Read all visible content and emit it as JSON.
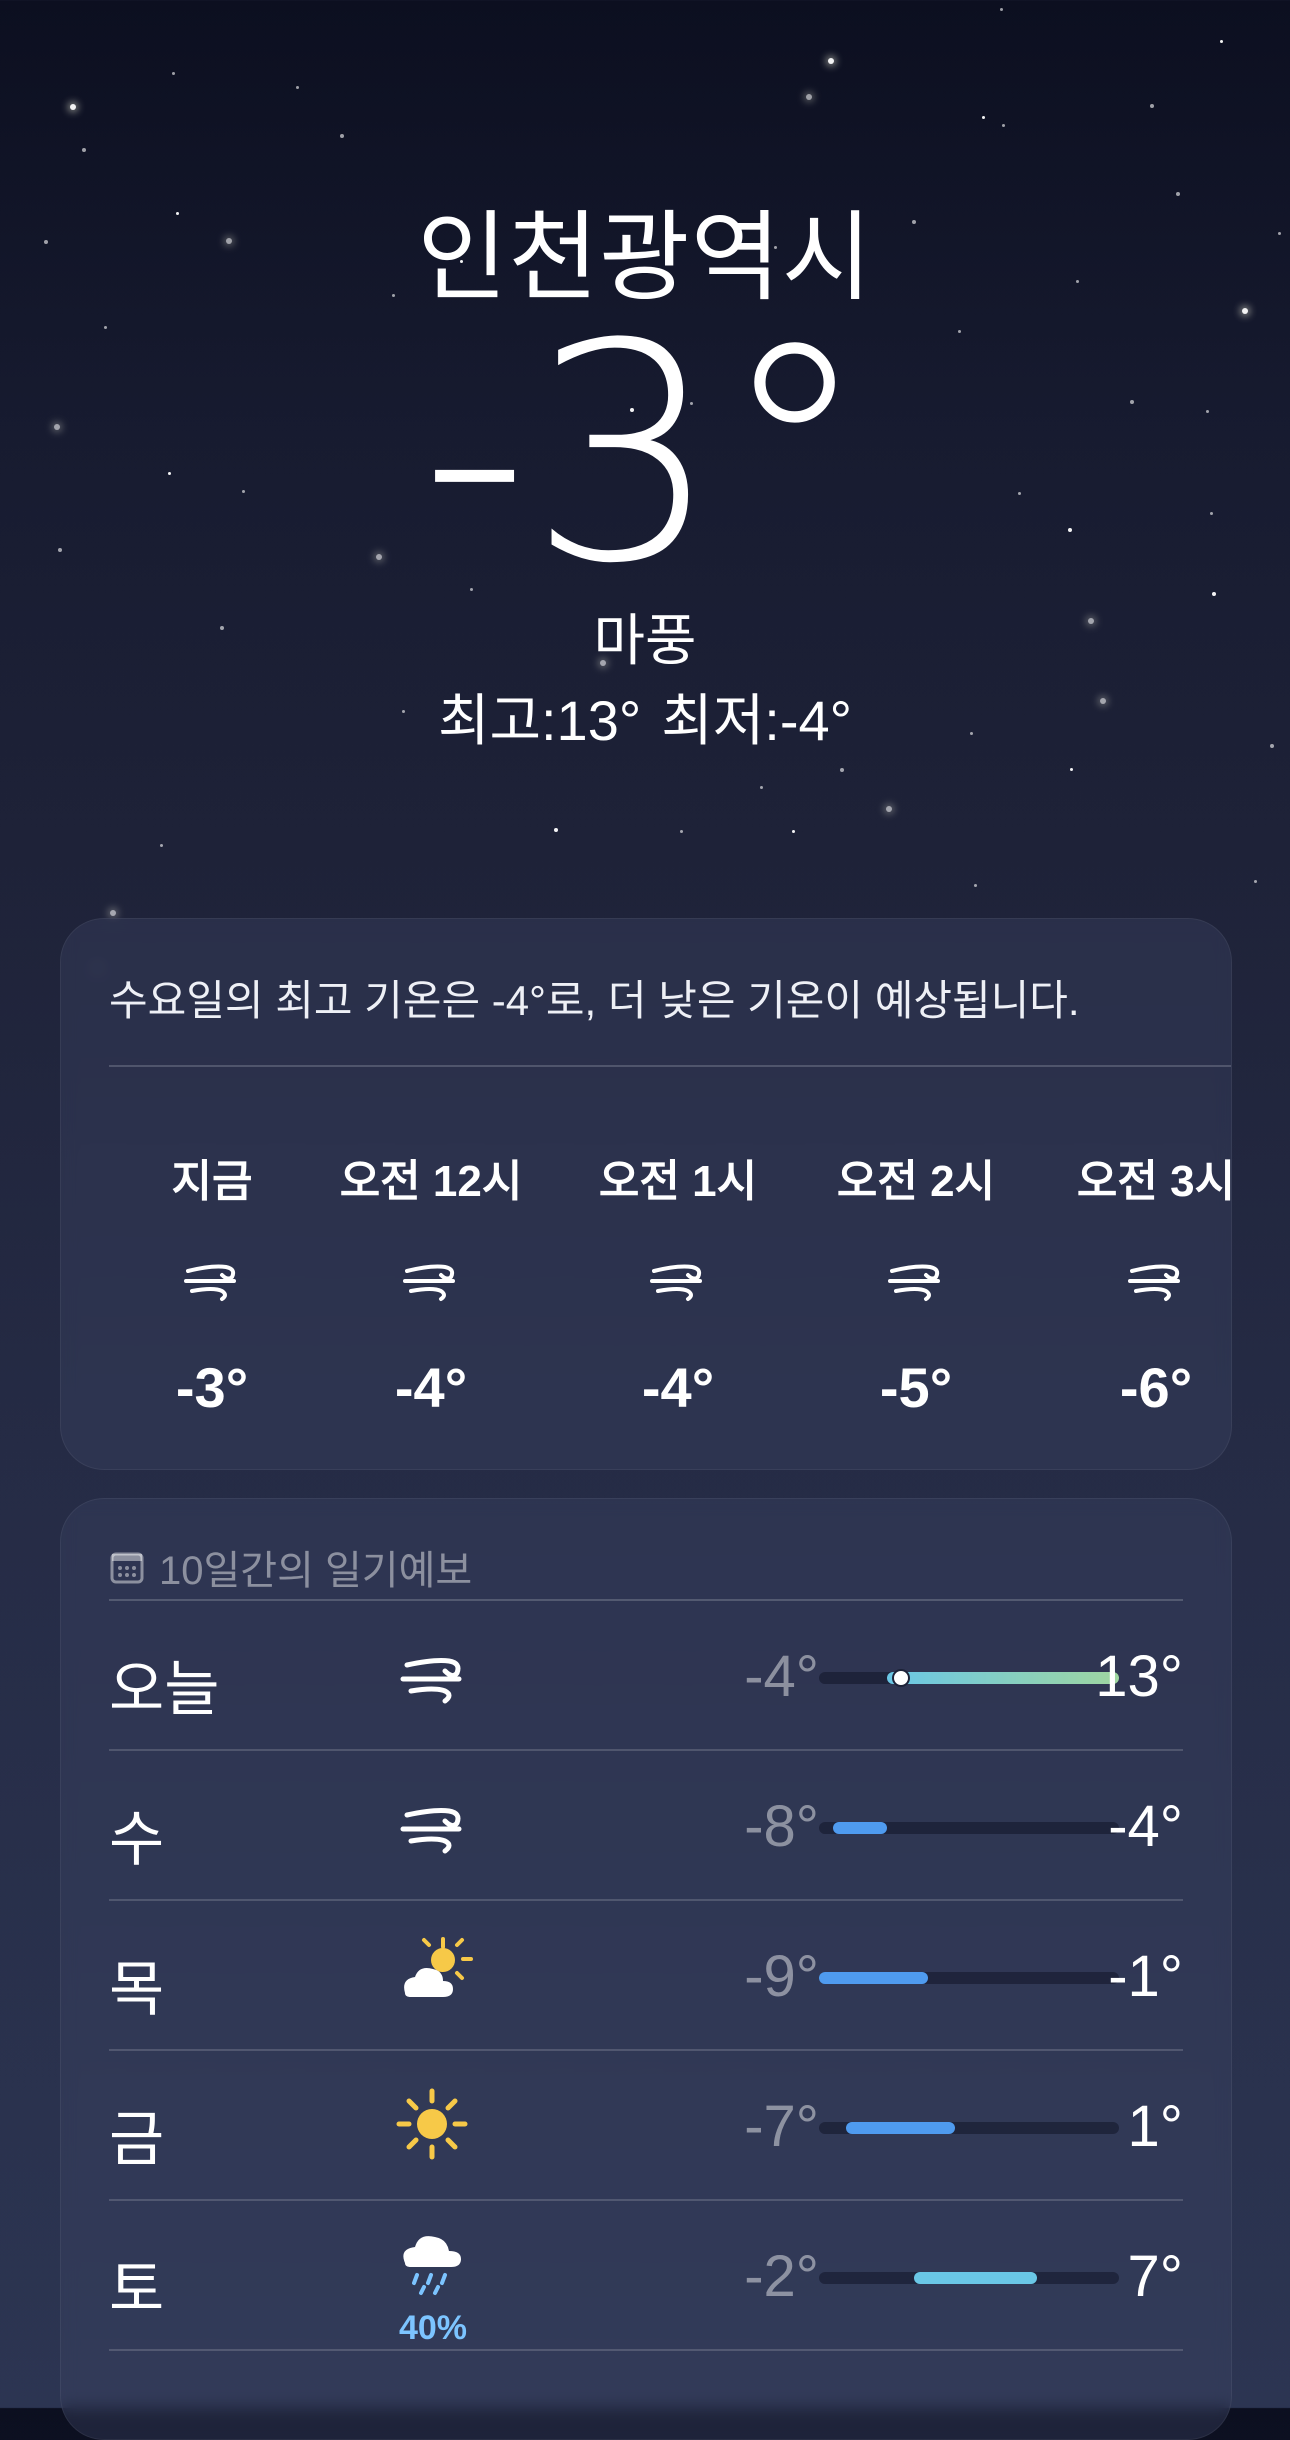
{
  "location": {
    "city": "인천광역시",
    "temperature": "-3°",
    "condition": "마풍",
    "high": "최고:13°",
    "low": "최저:-4°"
  },
  "hourly_card": {
    "summary": "수요일의 최고 기온은 -4°로, 더 낮은 기온이 예상됩니다.",
    "hours": [
      {
        "label": "지금",
        "icon": "wind-icon",
        "temp": "-3°"
      },
      {
        "label": "오전 12시",
        "icon": "wind-icon",
        "temp": "-4°"
      },
      {
        "label": "오전 1시",
        "icon": "wind-icon",
        "temp": "-4°"
      },
      {
        "label": "오전 2시",
        "icon": "wind-icon",
        "temp": "-5°"
      },
      {
        "label": "오전 3시",
        "icon": "wind-icon",
        "temp": "-6°"
      }
    ]
  },
  "daily_card": {
    "title": "10일간의 일기예보",
    "range_min": -9,
    "range_max": 13,
    "days": [
      {
        "day": "오늘",
        "icon": "wind-icon",
        "low": "-4°",
        "high": "13°",
        "low_val": -4,
        "high_val": 13,
        "current_val": -3,
        "precip": ""
      },
      {
        "day": "수",
        "icon": "wind-icon",
        "low": "-8°",
        "high": "-4°",
        "low_val": -8,
        "high_val": -4,
        "precip": ""
      },
      {
        "day": "목",
        "icon": "partly-sunny-icon",
        "low": "-9°",
        "high": "-1°",
        "low_val": -9,
        "high_val": -1,
        "precip": ""
      },
      {
        "day": "금",
        "icon": "sun-icon",
        "low": "-7°",
        "high": "1°",
        "low_val": -7,
        "high_val": 1,
        "precip": ""
      },
      {
        "day": "토",
        "icon": "rain-icon",
        "low": "-2°",
        "high": "7°",
        "low_val": -2,
        "high_val": 7,
        "precip": "40%"
      }
    ]
  },
  "colors": {
    "cold": "#4f9bef",
    "cool": "#6ac7e6",
    "mild": "#9fd6a0"
  }
}
